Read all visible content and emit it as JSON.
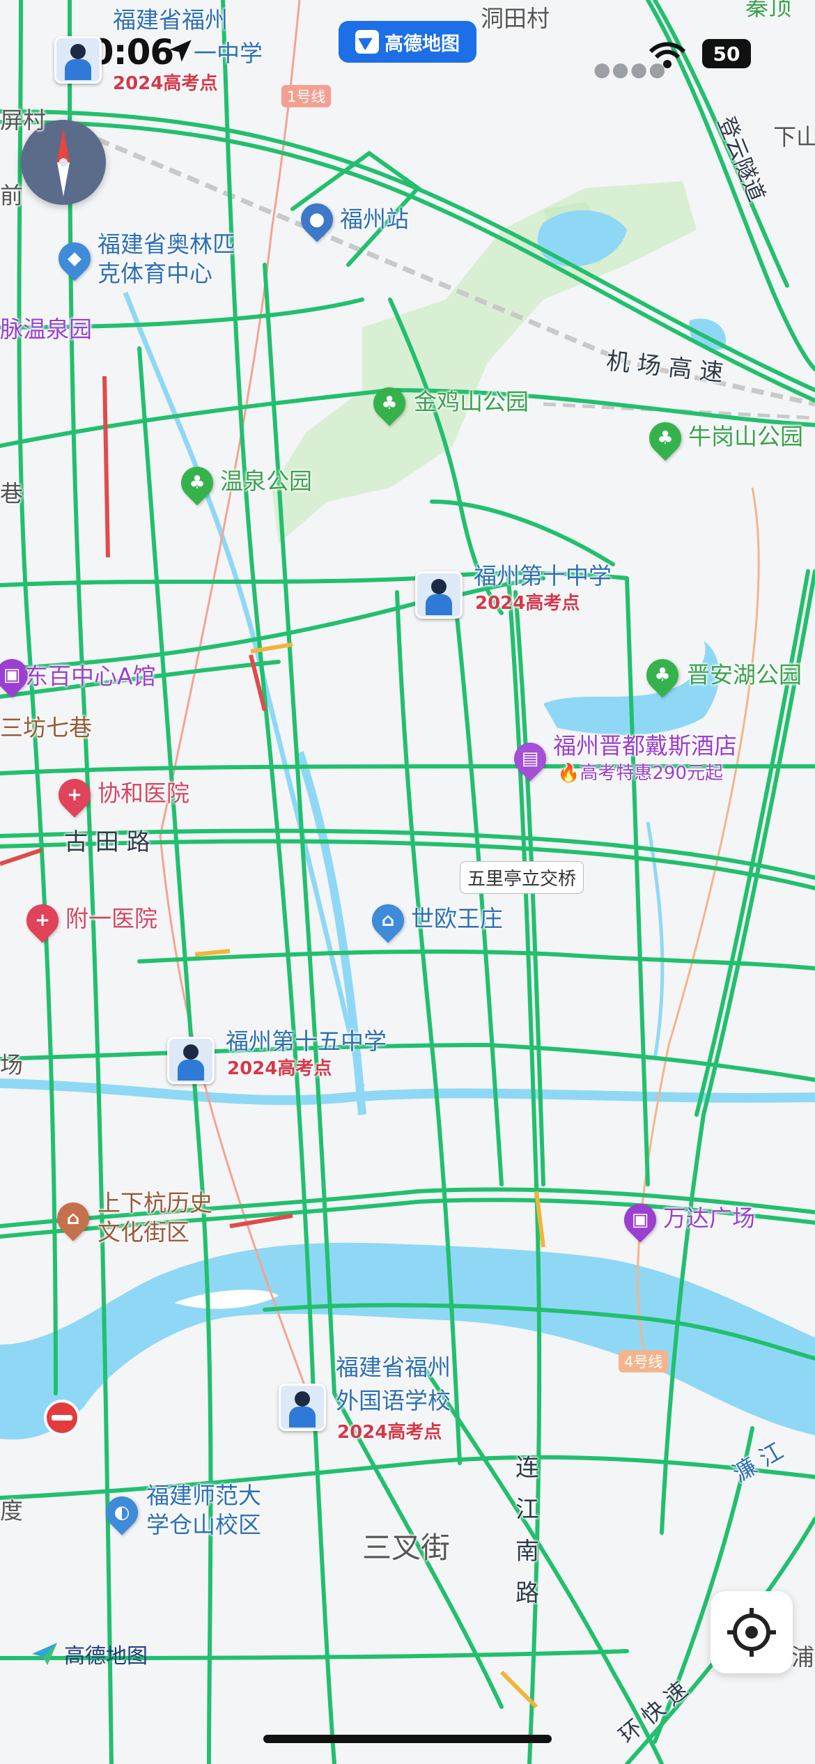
{
  "status_bar": {
    "time": "10:06",
    "battery": "50"
  },
  "app_badge": "高德地图",
  "brand_logo": "高德地图",
  "icons": [
    "location-arrow-icon",
    "wifi-icon",
    "compass-icon",
    "locate-icon",
    "hospital-icon",
    "hotel-icon",
    "park-icon",
    "school-avatar-icon",
    "train-station-icon",
    "mall-icon",
    "no-entry-icon"
  ],
  "colors": {
    "road": "#22bf6e",
    "water": "#8fd8f5",
    "park": "#d9efd3",
    "hospital": "#e0435a",
    "hotel": "#a350d6",
    "school_tag": "#d5384a"
  },
  "metro_labels": [
    "1号线",
    "4号线"
  ],
  "bridge": "五里亭立交桥",
  "roads": [
    "机 场 高 速",
    "古 田 路",
    "连",
    "江",
    "南",
    "路",
    "三叉街",
    "登云隧道",
    "环 快 速"
  ],
  "pois": [
    {
      "name": "福建省福州",
      "sub": "2024高考点",
      "line2": "一中学",
      "type": "school"
    },
    {
      "name": "洞田村",
      "type": "place"
    },
    {
      "name": "秦顶",
      "type": "park"
    },
    {
      "name": "下山",
      "type": "place"
    },
    {
      "name": "屏村",
      "type": "place"
    },
    {
      "name": "前",
      "type": "place"
    },
    {
      "name": "福州站",
      "type": "station"
    },
    {
      "name": "福建省奥林匹",
      "line2": "克体育中心",
      "type": "venue"
    },
    {
      "name": "脉温泉园",
      "type": "place"
    },
    {
      "name": "金鸡山公园",
      "type": "park"
    },
    {
      "name": "牛岗山公园",
      "type": "park"
    },
    {
      "name": "温泉公园",
      "type": "park"
    },
    {
      "name": "巷",
      "type": "place"
    },
    {
      "name": "福州第十中学",
      "sub": "2024高考点",
      "type": "school"
    },
    {
      "name": "东百中心A馆",
      "type": "mall"
    },
    {
      "name": "晋安湖公园",
      "type": "park"
    },
    {
      "name": "三坊七巷",
      "type": "scenic"
    },
    {
      "name": "福州晋都戴斯酒店",
      "sub": "高考特惠290元起",
      "type": "hotel"
    },
    {
      "name": "协和医院",
      "type": "hospital"
    },
    {
      "name": "附一医院",
      "type": "hospital"
    },
    {
      "name": "世欧王庄",
      "type": "place"
    },
    {
      "name": "福州第十五中学",
      "sub": "2024高考点",
      "type": "school"
    },
    {
      "name": "场",
      "type": "place"
    },
    {
      "name": "上下杭历史",
      "line2": "文化街区",
      "type": "scenic"
    },
    {
      "name": "万达广场",
      "type": "mall"
    },
    {
      "name": "福建省福州",
      "line2": "外国语学校",
      "sub": "2024高考点",
      "type": "school"
    },
    {
      "name": "福建师范大",
      "line2": "学仓山校区",
      "type": "school"
    },
    {
      "name": "度",
      "type": "place"
    },
    {
      "name": "濂 江",
      "type": "river"
    },
    {
      "name": "浦",
      "type": "place"
    }
  ]
}
